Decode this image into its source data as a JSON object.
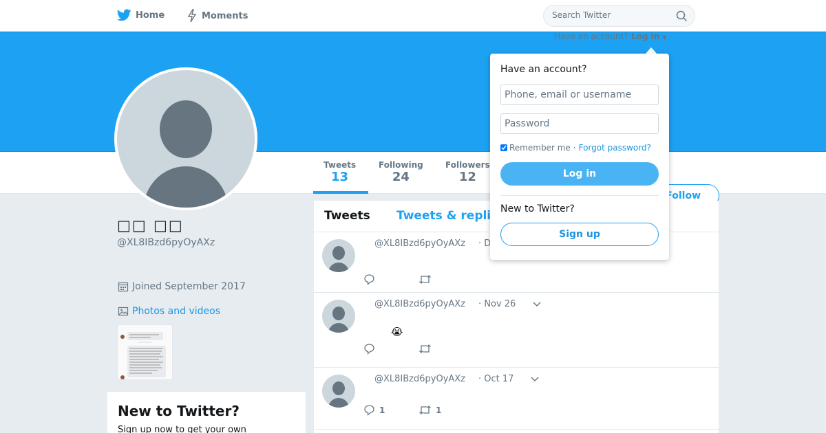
{
  "nav": {
    "home_label": "Home",
    "moments_label": "Moments",
    "search_placeholder": "Search Twitter"
  },
  "header": {
    "have_account_text": "Have an account?",
    "login_label": "Log in"
  },
  "stats": [
    {
      "label": "Tweets",
      "value": "13"
    },
    {
      "label": "Following",
      "value": "24"
    },
    {
      "label": "Followers",
      "value": "12"
    }
  ],
  "follow_label": "Follow",
  "profile": {
    "name": "□□ □□",
    "handle": "@XL8IBzd6pyOyAXz",
    "joined": "Joined September 2017",
    "photos_label": "Photos and videos"
  },
  "new_to_twitter_card": {
    "title": "New to Twitter?",
    "subtitle": "Sign up now to get your own"
  },
  "timeline": {
    "tab_tweets": "Tweets",
    "tab_replies": "Tweets & replies",
    "tweets": [
      {
        "handle": "@XL8IBzd6pyOyAXz",
        "date": "· D",
        "emoji": "",
        "reply_count": "",
        "retweet_count": ""
      },
      {
        "handle": "@XL8IBzd6pyOyAXz",
        "date": "· Nov 26",
        "emoji": "😭",
        "reply_count": "",
        "retweet_count": ""
      },
      {
        "handle": "@XL8IBzd6pyOyAXz",
        "date": "· Oct 17",
        "emoji": "",
        "reply_count": "1",
        "retweet_count": "1"
      }
    ]
  },
  "login_dropdown": {
    "title": "Have an account?",
    "username_placeholder": "Phone, email or username",
    "password_placeholder": "Password",
    "remember_label": "Remember me",
    "separator": "·",
    "forgot_label": "Forgot password?",
    "login_button": "Log in",
    "new_label": "New to Twitter?",
    "signup_button": "Sign up"
  },
  "colors": {
    "accent": "#1da1f2",
    "banner": "#1da1f2",
    "background": "#e6ecf0",
    "login_button": "#4ab3f4"
  }
}
